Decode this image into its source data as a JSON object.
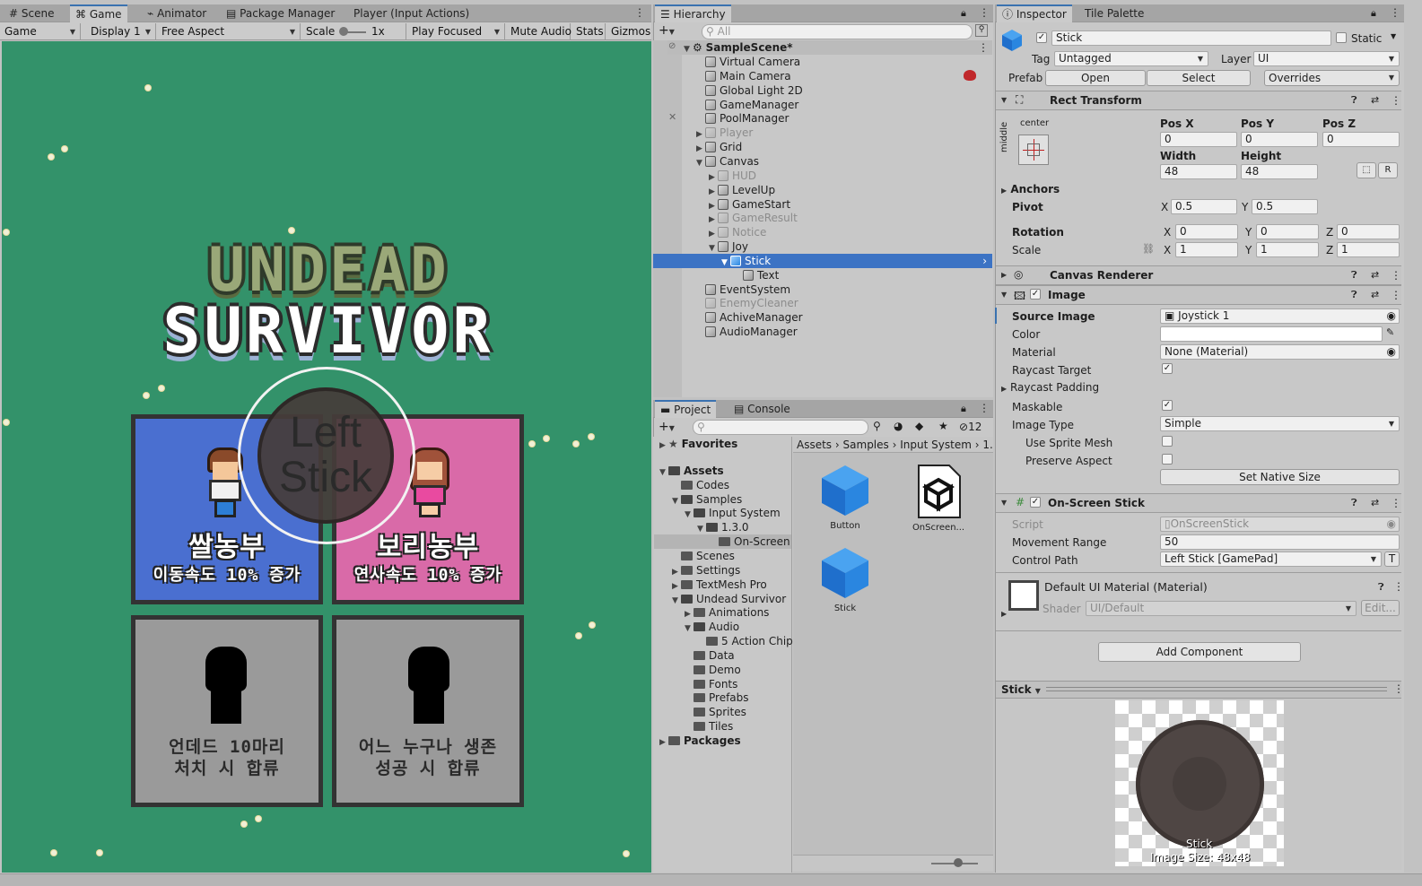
{
  "game_panel": {
    "tabs": [
      "Scene",
      "Game",
      "Animator",
      "Package Manager",
      "Player (Input Actions)"
    ],
    "toolbar": {
      "view": "Game",
      "display": "Display 1",
      "aspect": "Free Aspect",
      "scale_label": "Scale",
      "scale_value": "1x",
      "play_mode": "Play Focused",
      "mute": "Mute Audio",
      "stats": "Stats",
      "gizmos": "Gizmos"
    },
    "game_view": {
      "title_line1": "UNDEAD",
      "title_line2": "SURVIVOR",
      "joystick_label": "Left\nStick",
      "cards": [
        {
          "name": "쌀농부",
          "desc": "이동속도 10% 증가",
          "color": "#4a6fd0",
          "locked": false
        },
        {
          "name": "보리농부",
          "desc": "연사속도 10% 증가",
          "color": "#d96aa8",
          "locked": false
        },
        {
          "name": "",
          "desc": "언데드 10마리\n처치 시 합류",
          "color": "#9a9a9a",
          "locked": true
        },
        {
          "name": "",
          "desc": "어느 누구나 생존\n성공 시 합류",
          "color": "#9a9a9a",
          "locked": true
        }
      ],
      "grass_color": "#33926a"
    }
  },
  "hierarchy": {
    "tab": "Hierarchy",
    "search_placeholder": "All",
    "scene": "SampleScene*",
    "items": [
      {
        "label": "Virtual Camera",
        "depth": 1,
        "arrow": "",
        "dim": false
      },
      {
        "label": "Main Camera",
        "depth": 1,
        "arrow": "",
        "dim": false
      },
      {
        "label": "Global Light 2D",
        "depth": 1,
        "arrow": "",
        "dim": false
      },
      {
        "label": "GameManager",
        "depth": 1,
        "arrow": "",
        "dim": false
      },
      {
        "label": "PoolManager",
        "depth": 1,
        "arrow": "",
        "dim": false
      },
      {
        "label": "Player",
        "depth": 1,
        "arrow": "▶",
        "dim": true
      },
      {
        "label": "Grid",
        "depth": 1,
        "arrow": "▶",
        "dim": false
      },
      {
        "label": "Canvas",
        "depth": 1,
        "arrow": "▼",
        "dim": false
      },
      {
        "label": "HUD",
        "depth": 2,
        "arrow": "▶",
        "dim": true
      },
      {
        "label": "LevelUp",
        "depth": 2,
        "arrow": "▶",
        "dim": false
      },
      {
        "label": "GameStart",
        "depth": 2,
        "arrow": "▶",
        "dim": false
      },
      {
        "label": "GameResult",
        "depth": 2,
        "arrow": "▶",
        "dim": true
      },
      {
        "label": "Notice",
        "depth": 2,
        "arrow": "▶",
        "dim": true
      },
      {
        "label": "Joy",
        "depth": 2,
        "arrow": "▼",
        "dim": false
      },
      {
        "label": "Stick",
        "depth": 3,
        "arrow": "▼",
        "dim": false,
        "selected": true
      },
      {
        "label": "Text",
        "depth": 4,
        "arrow": "",
        "dim": false
      },
      {
        "label": "EventSystem",
        "depth": 1,
        "arrow": "",
        "dim": false
      },
      {
        "label": "EnemyCleaner",
        "depth": 1,
        "arrow": "",
        "dim": true
      },
      {
        "label": "AchiveManager",
        "depth": 1,
        "arrow": "",
        "dim": false
      },
      {
        "label": "AudioManager",
        "depth": 1,
        "arrow": "",
        "dim": false
      }
    ]
  },
  "project": {
    "tabs": [
      "Project",
      "Console"
    ],
    "hidden_count": "12",
    "tree": [
      {
        "label": "Favorites",
        "depth": 0,
        "arrow": "▶",
        "bold": true,
        "star": true
      },
      {
        "label": "Assets",
        "depth": 0,
        "arrow": "▼",
        "bold": true
      },
      {
        "label": "Codes",
        "depth": 1,
        "arrow": ""
      },
      {
        "label": "Samples",
        "depth": 1,
        "arrow": "▼"
      },
      {
        "label": "Input System",
        "depth": 2,
        "arrow": "▼"
      },
      {
        "label": "1.3.0",
        "depth": 3,
        "arrow": "▼"
      },
      {
        "label": "On-Screen",
        "depth": 4,
        "arrow": "",
        "selected": true
      },
      {
        "label": "Scenes",
        "depth": 1,
        "arrow": ""
      },
      {
        "label": "Settings",
        "depth": 1,
        "arrow": "▶"
      },
      {
        "label": "TextMesh Pro",
        "depth": 1,
        "arrow": "▶"
      },
      {
        "label": "Undead Survivor",
        "depth": 1,
        "arrow": "▼"
      },
      {
        "label": "Animations",
        "depth": 2,
        "arrow": "▶"
      },
      {
        "label": "Audio",
        "depth": 2,
        "arrow": "▼"
      },
      {
        "label": "5 Action Chipt",
        "depth": 3,
        "arrow": ""
      },
      {
        "label": "Data",
        "depth": 2,
        "arrow": ""
      },
      {
        "label": "Demo",
        "depth": 2,
        "arrow": ""
      },
      {
        "label": "Fonts",
        "depth": 2,
        "arrow": ""
      },
      {
        "label": "Prefabs",
        "depth": 2,
        "arrow": ""
      },
      {
        "label": "Sprites",
        "depth": 2,
        "arrow": ""
      },
      {
        "label": "Tiles",
        "depth": 2,
        "arrow": ""
      },
      {
        "label": "Packages",
        "depth": 0,
        "arrow": "▶",
        "bold": true
      }
    ],
    "breadcrumb": [
      "Assets",
      "Samples",
      "Input System",
      "1."
    ],
    "assets": [
      "Button",
      "OnScreen...",
      "Stick"
    ]
  },
  "inspector": {
    "tabs": [
      "Inspector",
      "Tile Palette"
    ],
    "object_name": "Stick",
    "static_label": "Static",
    "tag_label": "Tag",
    "tag": "Untagged",
    "layer_label": "Layer",
    "layer": "UI",
    "prefab_label": "Prefab",
    "prefab_open": "Open",
    "prefab_select": "Select",
    "prefab_overrides": "Overrides",
    "rect_transform": {
      "title": "Rect Transform",
      "anchor_h": "center",
      "anchor_v": "middle",
      "pos_x_label": "Pos X",
      "pos_x": "0",
      "pos_y_label": "Pos Y",
      "pos_y": "0",
      "pos_z_label": "Pos Z",
      "pos_z": "0",
      "width_label": "Width",
      "width": "48",
      "height_label": "Height",
      "height": "48",
      "anchors_label": "Anchors",
      "pivot_label": "Pivot",
      "pivot_x": "0.5",
      "pivot_y": "0.5",
      "rotation_label": "Rotation",
      "rot_x": "0",
      "rot_y": "0",
      "rot_z": "0",
      "scale_label": "Scale",
      "scale_x": "1",
      "scale_y": "1",
      "scale_z": "1",
      "r_button": "R"
    },
    "canvas_renderer": "Canvas Renderer",
    "image": {
      "title": "Image",
      "source_image_label": "Source Image",
      "source_image": "Joystick 1",
      "color_label": "Color",
      "material_label": "Material",
      "material": "None (Material)",
      "raycast_target_label": "Raycast Target",
      "raycast_padding_label": "Raycast Padding",
      "maskable_label": "Maskable",
      "image_type_label": "Image Type",
      "image_type": "Simple",
      "use_sprite_mesh_label": "Use Sprite Mesh",
      "preserve_aspect_label": "Preserve Aspect",
      "set_native_size": "Set Native Size"
    },
    "on_screen_stick": {
      "title": "On-Screen Stick",
      "script_label": "Script",
      "script": "OnScreenStick",
      "movement_range_label": "Movement Range",
      "movement_range": "50",
      "control_path_label": "Control Path",
      "control_path": "Left Stick [GamePad]",
      "t_button": "T"
    },
    "material_block": {
      "title": "Default UI Material (Material)",
      "shader_label": "Shader",
      "shader": "UI/Default",
      "edit": "Edit..."
    },
    "add_component": "Add Component",
    "preview": {
      "dropdown": "Stick",
      "caption": "Stick",
      "size_text": "Image Size: 48x48"
    }
  },
  "colors": {
    "accent": "#3a72b0",
    "selection": "#3c73c4",
    "grass": "#33926a"
  }
}
